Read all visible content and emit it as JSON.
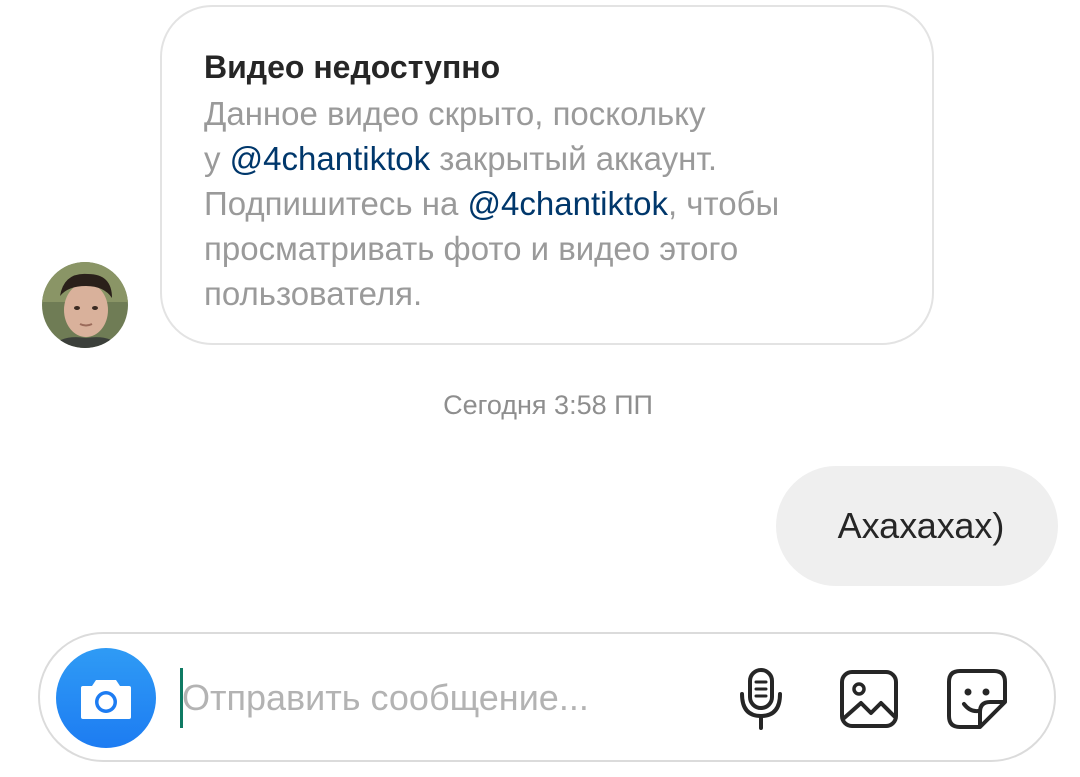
{
  "thread": {
    "incoming_card": {
      "title": "Видео недоступно",
      "lines": [
        {
          "pre": "Данное видео скрыто, поскольку",
          "mention": "",
          "post": ""
        },
        {
          "pre": "у ",
          "mention": "@4chantiktok",
          "post": " закрытый аккаунт."
        },
        {
          "pre": "Подпишитесь на ",
          "mention": "@4chantiktok",
          "post": ", чтобы"
        },
        {
          "pre": "просматривать фото и видео этого",
          "mention": "",
          "post": ""
        },
        {
          "pre": "пользователя.",
          "mention": "",
          "post": ""
        }
      ]
    },
    "timestamp": "Сегодня 3:58 ПП",
    "outgoing_message": "Ахахахах)"
  },
  "composer": {
    "placeholder": "Отправить сообщение...",
    "value": ""
  },
  "icons": {
    "avatar": "avatar",
    "camera": "camera-icon",
    "mic": "microphone-icon",
    "gallery": "gallery-icon",
    "sticker": "sticker-icon"
  },
  "colors": {
    "accent_blue": "#1d7cf2",
    "mention": "#00376b",
    "muted_text": "#9a9a9a",
    "bubble_bg": "#efefef",
    "caret": "#0f7a63"
  }
}
